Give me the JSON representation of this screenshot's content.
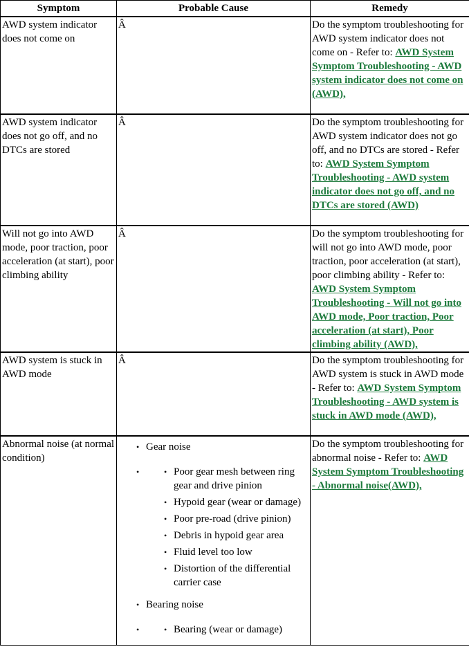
{
  "table": {
    "headers": {
      "symptom": "Symptom",
      "cause": "Probable Cause",
      "remedy": "Remedy"
    },
    "rows": [
      {
        "symptom": "AWD system indicator does not come on",
        "cause": "Â",
        "remedy_text": "Do the symptom troubleshooting for AWD system indicator does not come on - Refer to: ",
        "remedy_link": "AWD System Symptom Troubleshooting - AWD system indicator does not come on (AWD),"
      },
      {
        "symptom": "AWD system indicator does not go off, and no DTCs are stored",
        "cause": "Â",
        "remedy_text": "Do the symptom troubleshooting for AWD system indicator does not go off, and no DTCs are stored - Refer to: ",
        "remedy_link": "AWD System Symptom Troubleshooting - AWD system indicator does not go off, and no DTCs are stored (AWD)"
      },
      {
        "symptom": "Will not go into AWD mode, poor traction, poor acceleration (at start), poor climbing ability",
        "cause": "Â",
        "remedy_text": "Do the symptom troubleshooting for will not go into AWD mode, poor traction, poor acceleration (at start), poor climbing ability - Refer to: ",
        "remedy_link": "AWD System Symptom Troubleshooting - Will not go into AWD mode, Poor traction, Poor acceleration (at start), Poor climbing ability (AWD),"
      },
      {
        "symptom": "AWD system is stuck in AWD mode",
        "cause": "Â",
        "remedy_text": "Do the symptom troubleshooting for AWD system is stuck in AWD mode - Refer to: ",
        "remedy_link": "AWD System Symptom Troubleshooting - AWD system is stuck in AWD mode (AWD),"
      },
      {
        "symptom": "Abnormal noise (at normal condition)",
        "cause_groups": [
          {
            "title": "Gear noise",
            "items": [
              "Poor gear mesh between ring gear and drive pinion",
              "Hypoid gear (wear or damage)",
              "Poor pre-road (drive pinion)",
              "Debris in hypoid gear area",
              "Fluid level too low",
              "Distortion of the differential carrier case"
            ]
          },
          {
            "title": "Bearing noise",
            "items": [
              "Bearing (wear or damage)"
            ]
          }
        ],
        "remedy_text": "Do the symptom troubleshooting for abnormal noise - Refer to: ",
        "remedy_link": "AWD System Symptom Troubleshooting - Abnormal noise(AWD),"
      }
    ]
  },
  "icons": {
    "bullet": "•"
  },
  "colors": {
    "link": "#1d7a3c"
  }
}
